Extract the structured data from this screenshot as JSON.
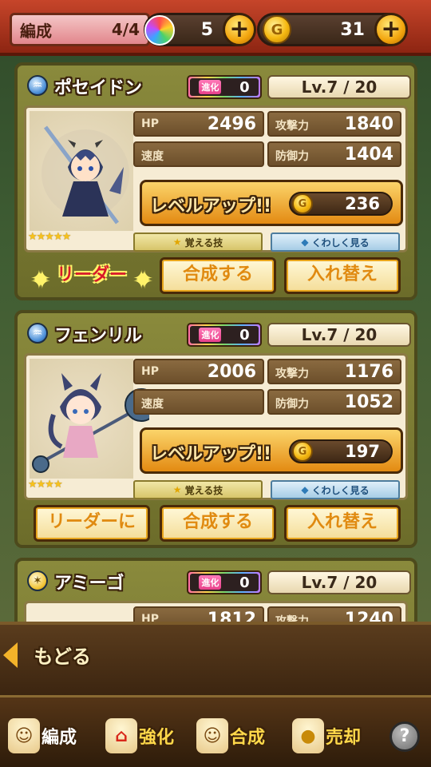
{
  "header": {
    "formation_label": "編成",
    "formation_count": "4/4",
    "gems": "5",
    "gold": "31",
    "plus": "+"
  },
  "colors": {
    "accent": "#e8a51c",
    "header_red": "#c6452a",
    "card_olive": "#7a7a34"
  },
  "common": {
    "evo_label": "進化",
    "hp_label": "HP",
    "atk_label": "攻撃力",
    "spd_label": "速度",
    "def_label": "防御力",
    "levelup_label": "レベルアップ!!",
    "skill_label": "覚える技",
    "detail_label": "くわしく見る",
    "merge_label": "合成する",
    "swap_label": "入れ替え",
    "set_leader_label": "リーダーに",
    "leader_badge": "リーダー",
    "coin_glyph": "G"
  },
  "characters": [
    {
      "name": "ポセイドン",
      "element": "water-element",
      "evolution": "0",
      "level": "Lv.7 / 20",
      "hp": "2496",
      "attack": "1840",
      "speed": "",
      "defense": "1404",
      "levelup_cost": "236",
      "rarity_stars": "★★★★★",
      "is_leader": true
    },
    {
      "name": "フェンリル",
      "element": "water-element",
      "evolution": "0",
      "level": "Lv.7 / 20",
      "hp": "2006",
      "attack": "1176",
      "speed": "",
      "defense": "1052",
      "levelup_cost": "197",
      "rarity_stars": "★★★★",
      "is_leader": false
    },
    {
      "name": "アミーゴ",
      "element": "light-element",
      "evolution": "0",
      "level": "Lv.7 / 20",
      "hp": "1812",
      "attack": "1240"
    }
  ],
  "footer": {
    "back_label": "もどる",
    "tabs": [
      {
        "label": "編成",
        "icon": "formation-icon"
      },
      {
        "label": "強化",
        "icon": "enhance-icon"
      },
      {
        "label": "合成",
        "icon": "merge-icon"
      },
      {
        "label": "売却",
        "icon": "sell-icon"
      }
    ],
    "help": "?"
  }
}
